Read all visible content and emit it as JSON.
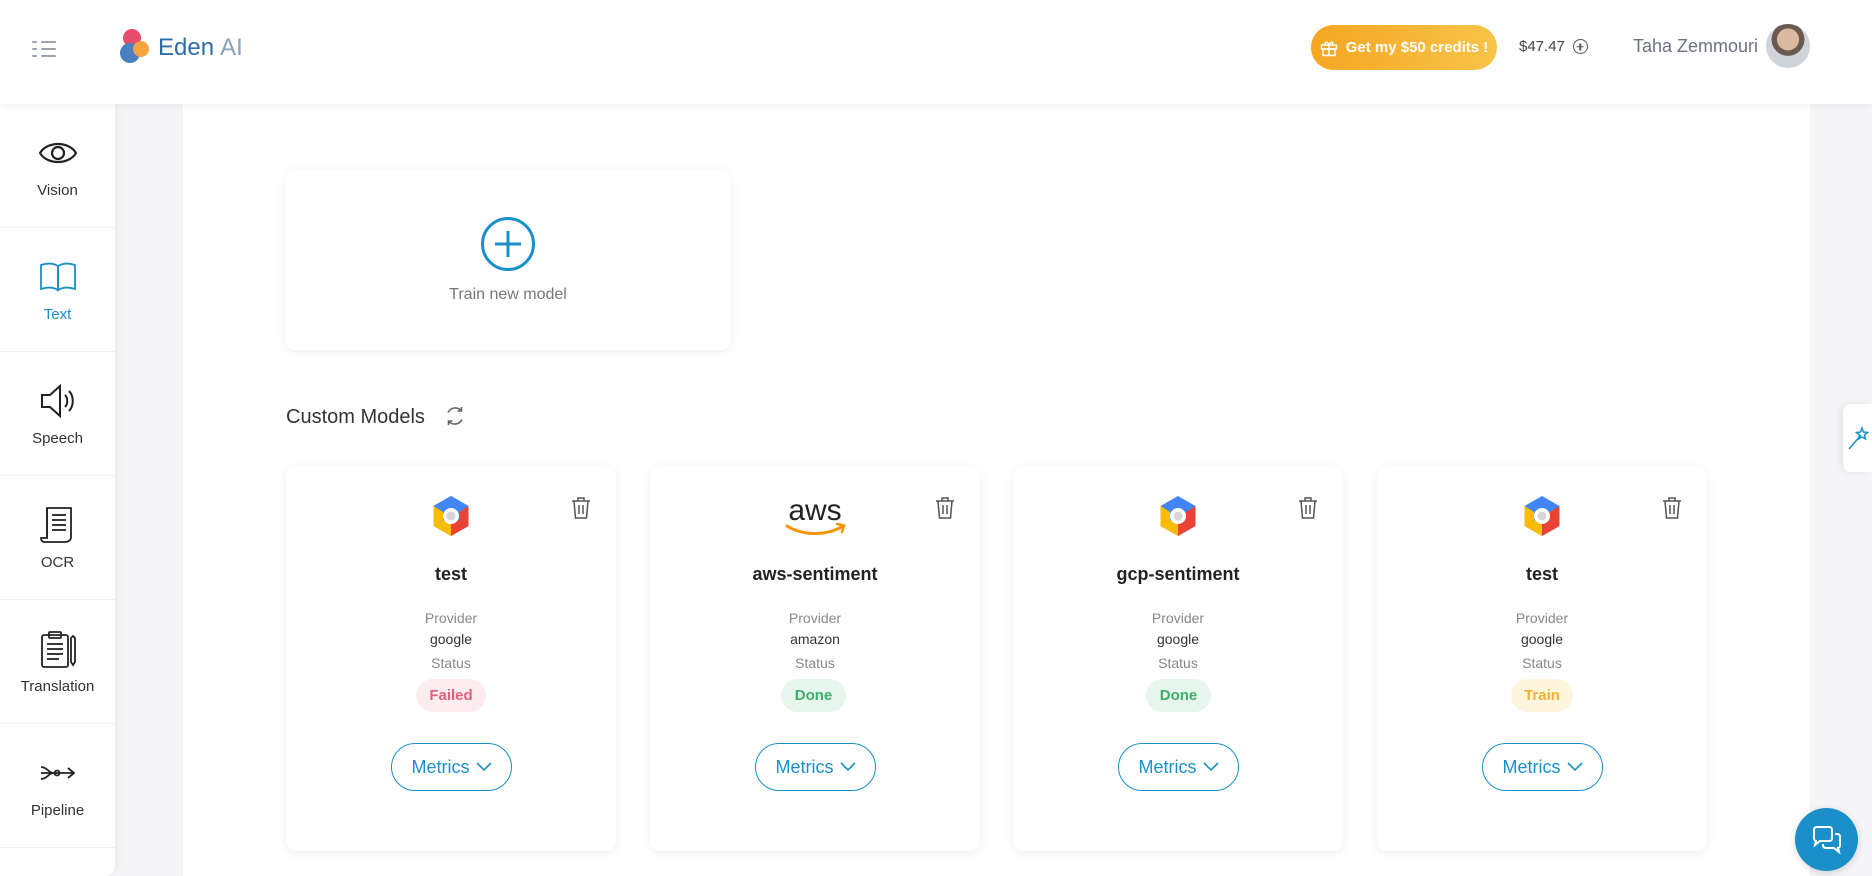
{
  "header": {
    "logo_text": "Eden",
    "logo_suffix": "AI",
    "credits_button": "Get my $50 credits !",
    "balance": "$47.47",
    "user_name": "Taha Zemmouri"
  },
  "sidebar": {
    "items": [
      {
        "label": "Vision",
        "icon": "eye-icon"
      },
      {
        "label": "Text",
        "icon": "book-icon",
        "active": true
      },
      {
        "label": "Speech",
        "icon": "speaker-icon"
      },
      {
        "label": "OCR",
        "icon": "scroll-icon"
      },
      {
        "label": "Translation",
        "icon": "clipboard-icon"
      },
      {
        "label": "Pipeline",
        "icon": "pipeline-icon"
      }
    ]
  },
  "main": {
    "train_new_label": "Train new model",
    "custom_models_title": "Custom Models",
    "models": [
      {
        "name": "test",
        "provider_label": "Provider",
        "provider": "google",
        "status_label": "Status",
        "status": "Failed",
        "metrics_label": "Metrics"
      },
      {
        "name": "aws-sentiment",
        "provider_label": "Provider",
        "provider": "amazon",
        "status_label": "Status",
        "status": "Done",
        "metrics_label": "Metrics"
      },
      {
        "name": "gcp-sentiment",
        "provider_label": "Provider",
        "provider": "google",
        "status_label": "Status",
        "status": "Done",
        "metrics_label": "Metrics"
      },
      {
        "name": "test",
        "provider_label": "Provider",
        "provider": "google",
        "status_label": "Status",
        "status": "Train",
        "metrics_label": "Metrics"
      }
    ]
  },
  "aws_logo_text": "aws",
  "colors": {
    "accent": "#1a8fc9",
    "credits": "#f5a623",
    "failed": "#e0607a",
    "done": "#3fae6a",
    "train": "#f0b232"
  }
}
